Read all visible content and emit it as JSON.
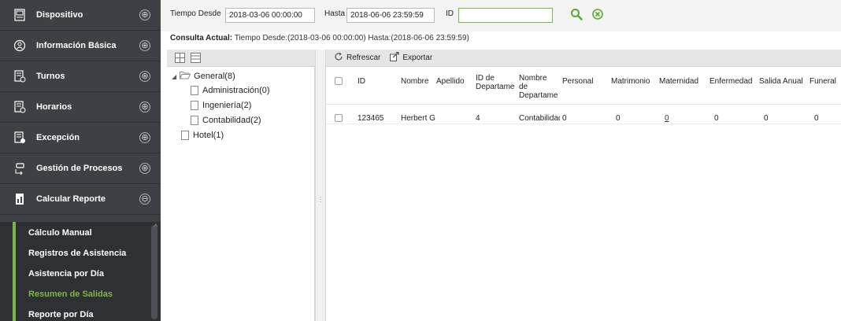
{
  "sidebar": {
    "items": [
      {
        "label": "Dispositivo",
        "icon": "device-icon"
      },
      {
        "label": "Información Básica",
        "icon": "basic-info-icon"
      },
      {
        "label": "Turnos",
        "icon": "shifts-icon"
      },
      {
        "label": "Horarios",
        "icon": "schedules-icon"
      },
      {
        "label": "Excepción",
        "icon": "exception-icon"
      },
      {
        "label": "Gestión de Procesos",
        "icon": "process-icon"
      },
      {
        "label": "Calcular Reporte",
        "icon": "report-icon"
      }
    ],
    "expand_symbol": "⊕",
    "collapse_symbol": "⊖",
    "submenu": [
      {
        "label": "Cálculo Manual"
      },
      {
        "label": "Registros de Asistencia"
      },
      {
        "label": "Asistencia por Día"
      },
      {
        "label": "Resumen de Salidas"
      },
      {
        "label": "Reporte por Día"
      }
    ],
    "active_color": "#7ab648"
  },
  "filter": {
    "from_label": "Tiempo Desde",
    "from_value": "2018-03-06 00:00:00",
    "to_label": "Hasta",
    "to_value": "2018-06-06 23:59:59",
    "id_label": "ID",
    "id_value": ""
  },
  "consulta": {
    "label": "Consulta Actual:",
    "text": "Tiempo Desde:(2018-03-06 00:00:00)  Hasta:(2018-06-06 23:59:59)"
  },
  "tree": {
    "root": "General(8)",
    "children": [
      "Administración(0)",
      "Ingeniería(2)",
      "Contabilidad(2)"
    ],
    "sibling": "Hotel(1)"
  },
  "toolbar": {
    "refresh_label": "Refrescar",
    "export_label": "Exportar"
  },
  "grid": {
    "columns": [
      "ID",
      "Nombre",
      "Apellido",
      "ID de Departame",
      "Nombre de Departame",
      "Personal",
      "Matrimonio",
      "Maternidad",
      "Enfermedad",
      "Salida Anual",
      "Funeral"
    ],
    "rows": [
      [
        "123465",
        "Herbert G",
        "",
        "4",
        "Contabilidad",
        "0",
        "0",
        "0",
        "0",
        "0",
        "0"
      ]
    ]
  }
}
